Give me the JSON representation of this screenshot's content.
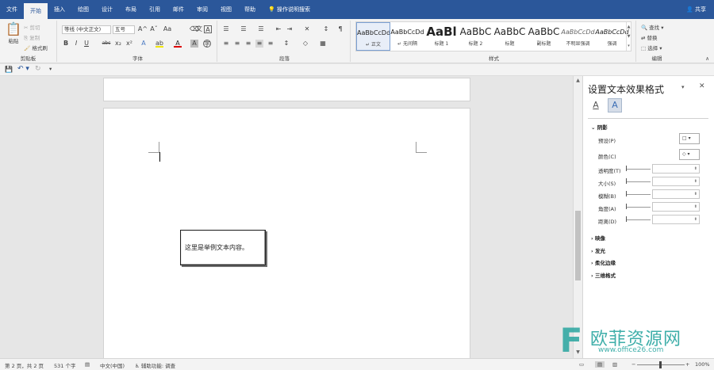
{
  "menu": {
    "items": [
      "文件",
      "开始",
      "插入",
      "绘图",
      "设计",
      "布局",
      "引用",
      "邮件",
      "审阅",
      "视图",
      "帮助"
    ],
    "search": "操作说明搜索",
    "share": "共享"
  },
  "ribbon": {
    "clipboard": {
      "paste": "粘贴",
      "cut": "剪切",
      "copy": "复制",
      "format_painter": "格式刷",
      "label": "剪贴板"
    },
    "font": {
      "font_name": "等线 (中文正文)",
      "font_size": "五号",
      "label": "字体",
      "bold": "B",
      "italic": "I",
      "underline": "U",
      "strike": "abc",
      "sub": "x₂",
      "sup": "x²",
      "grow": "A^",
      "shrink": "Aˇ",
      "case": "Aa",
      "highlight": "ab",
      "color": "A",
      "border_char": "A"
    },
    "paragraph": {
      "label": "段落"
    },
    "styles": {
      "label": "样式",
      "items": [
        {
          "sample": "AaBbCcDd",
          "name": "↵ 正文"
        },
        {
          "sample": "AaBbCcDd",
          "name": "↵ 无间隔"
        },
        {
          "sample": "AaBl",
          "name": "标题 1"
        },
        {
          "sample": "AaBbC",
          "name": "标题 2"
        },
        {
          "sample": "AaBbC",
          "name": "标题"
        },
        {
          "sample": "AaBbC",
          "name": "副标题"
        },
        {
          "sample": "AaBbCcDd",
          "name": "不明显强调"
        },
        {
          "sample": "AaBbCcDd",
          "name": "强调"
        }
      ]
    },
    "editing": {
      "find": "查找",
      "replace": "替换",
      "select": "选择",
      "label": "编辑"
    }
  },
  "document": {
    "textbox_text": "这里是举例文本内容。"
  },
  "pane": {
    "title": "设置文本效果格式",
    "section_shadow": "阴影",
    "preset_label": "预设(P)",
    "color_label": "颜色(C)",
    "props": [
      "透明度(T)",
      "大小(S)",
      "模糊(B)",
      "角度(A)",
      "距离(D)"
    ],
    "sections": [
      "映像",
      "发光",
      "柔化边缘",
      "三维格式"
    ]
  },
  "status": {
    "page": "第 2 页，共 2 页",
    "words": "531 个字",
    "language": "中文(中国)",
    "accessibility": "辅助功能: 调查",
    "zoom": "100%"
  },
  "watermark": {
    "text": "欧菲资源网",
    "url": "www.office26.com"
  }
}
